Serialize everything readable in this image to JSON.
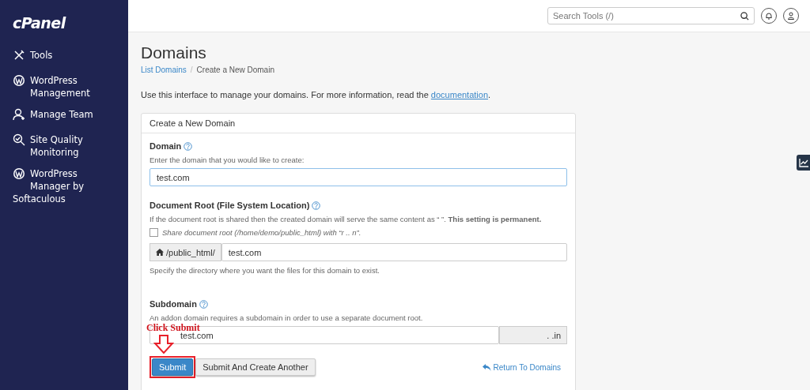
{
  "sidebar": {
    "logo": "cPanel",
    "items": [
      {
        "label": "Tools",
        "kind": "tools"
      },
      {
        "label": "WordPress Management",
        "kind": "wordpress"
      },
      {
        "label": "Manage Team",
        "kind": "team"
      },
      {
        "label": "Site Quality Monitoring",
        "kind": "quality"
      },
      {
        "label": "WordPress Manager by Softaculous",
        "kind": "wordpress"
      }
    ]
  },
  "topbar": {
    "search": {
      "placeholder": "Search Tools (/)"
    }
  },
  "page": {
    "title": "Domains",
    "breadcrumb": [
      {
        "label": "List Domains",
        "link": true
      },
      {
        "label": "Create a New Domain",
        "link": false
      }
    ],
    "separator": "/",
    "intro": "Use this interface to manage your domains. For more information, read the",
    "intro_link": "documentation",
    "intro_end": "."
  },
  "form": {
    "title": "Create a New Domain",
    "domain": {
      "label": "Domain",
      "hint": "Enter the domain that you would like to create:",
      "value": "test.com"
    },
    "docroot": {
      "label": "Document Root (File System Location)",
      "hint": "If the document root is shared then the created domain will serve the same content as “                    ”. **This setting is permanent.**",
      "share_label": "Share document root (/home/demo/public_html) with “r  ..                 n”.",
      "share_checked": false,
      "prefix": "/public_html/",
      "value": "test.com",
      "help": "Specify the directory where you want the files for this domain to exist."
    },
    "subdomain": {
      "label": "Subdomain",
      "hint": "An addon domain requires a subdomain in order to use a separate document root.",
      "value": "test.com",
      "suffix": ".                     .in"
    },
    "buttons": [
      {
        "label": "Submit",
        "kind": "primary"
      },
      {
        "label": "Submit And Create Another",
        "kind": "default"
      }
    ],
    "return_link": "Return To Domains"
  },
  "annotation": {
    "text": "Click Submit"
  }
}
